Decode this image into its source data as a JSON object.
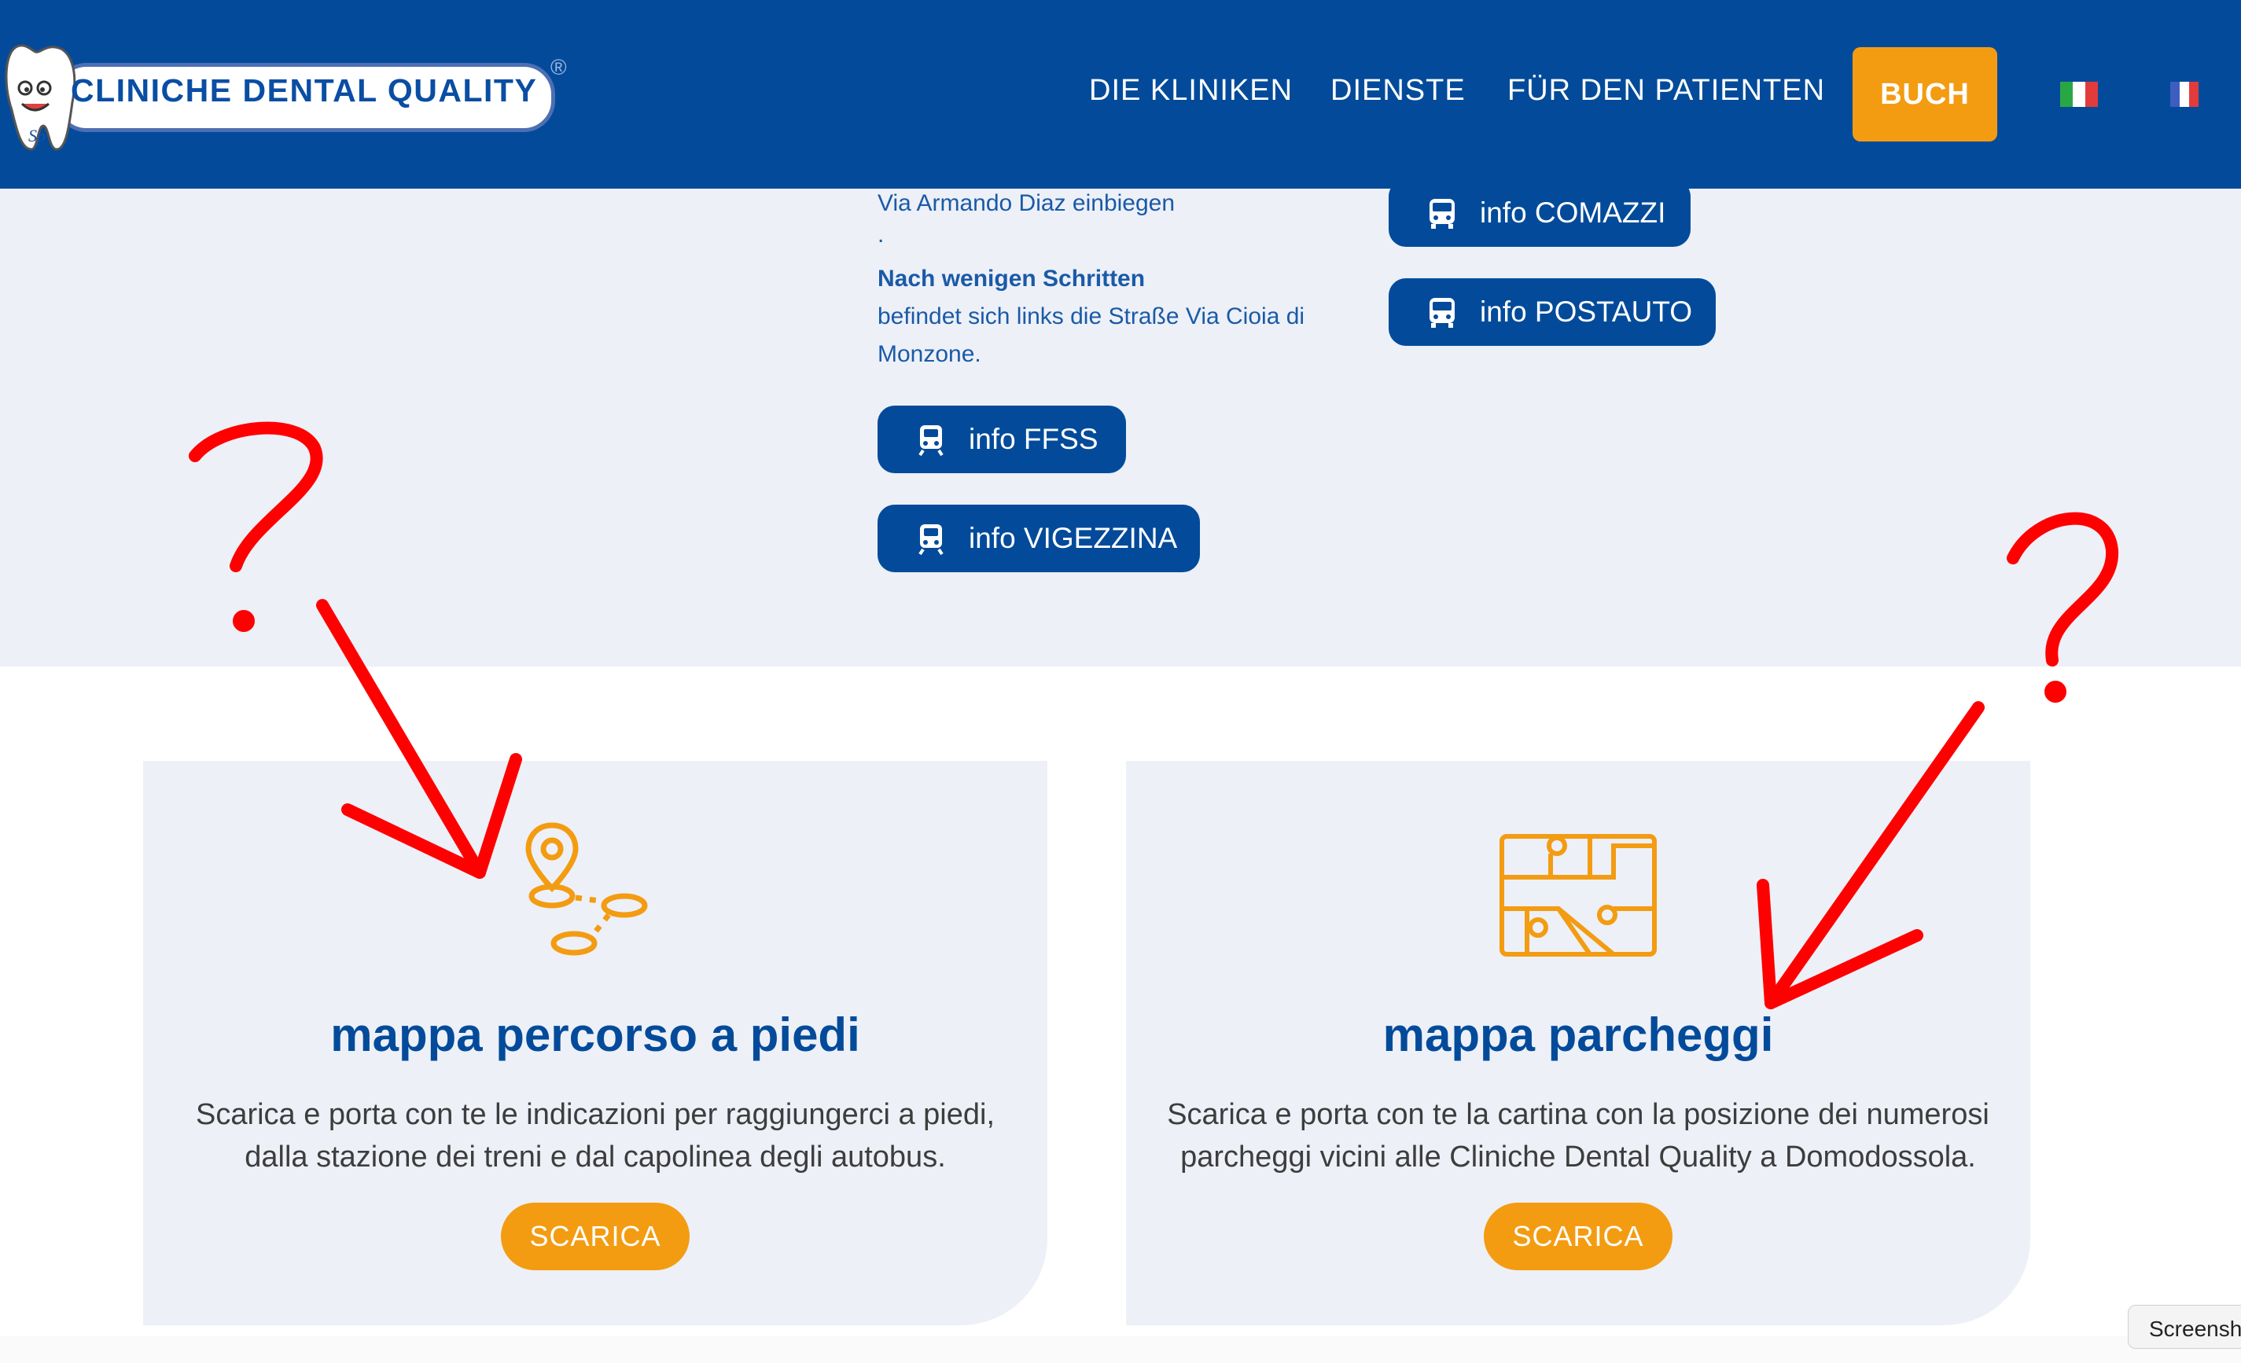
{
  "header": {
    "logo_text": "CLINICHE DENTAL QUALITY",
    "logo_mark": "®",
    "nav": [
      "DIE KLINIKEN",
      "DIENSTE",
      "FÜR DEN PATIENTEN"
    ],
    "book_label": "BUCH",
    "flags": [
      "italian-flag",
      "french-flag"
    ]
  },
  "directions": {
    "line1": "Via Armando Diaz einbiegen",
    "line2": ".",
    "line3_bold": "Nach wenigen Schritten",
    "line4": "befindet sich links die Straße Via Cioia di",
    "line5": "Monzone."
  },
  "transit_buttons": {
    "ffss": "info FFSS",
    "vigezzina": "info VIGEZZINA",
    "comazzi": "info COMAZZI",
    "postauto": "info POSTAUTO"
  },
  "cards": [
    {
      "title": "mappa percorso a piedi",
      "desc_line1": "Scarica e porta con te le indicazioni per raggiungerci a piedi,",
      "desc_line2": "dalla stazione dei treni e dal capolinea degli autobus.",
      "button": "SCARICA",
      "icon": "walking-route-icon"
    },
    {
      "title": "mappa parcheggi",
      "desc_line1": "Scarica e porta con te la cartina con la posizione dei numerosi",
      "desc_line2": "parcheggi vicini alle Cliniche Dental Quality a Domodossola.",
      "button": "SCARICA",
      "icon": "parking-map-icon"
    }
  ],
  "annotations": {
    "marks": [
      "?",
      "?"
    ],
    "color": "#ff0000"
  },
  "screenshot_tab": "Screenshot",
  "colors": {
    "brand_blue": "#034b9a",
    "accent_orange": "#f39c12",
    "band_grey": "#edf0f7"
  }
}
